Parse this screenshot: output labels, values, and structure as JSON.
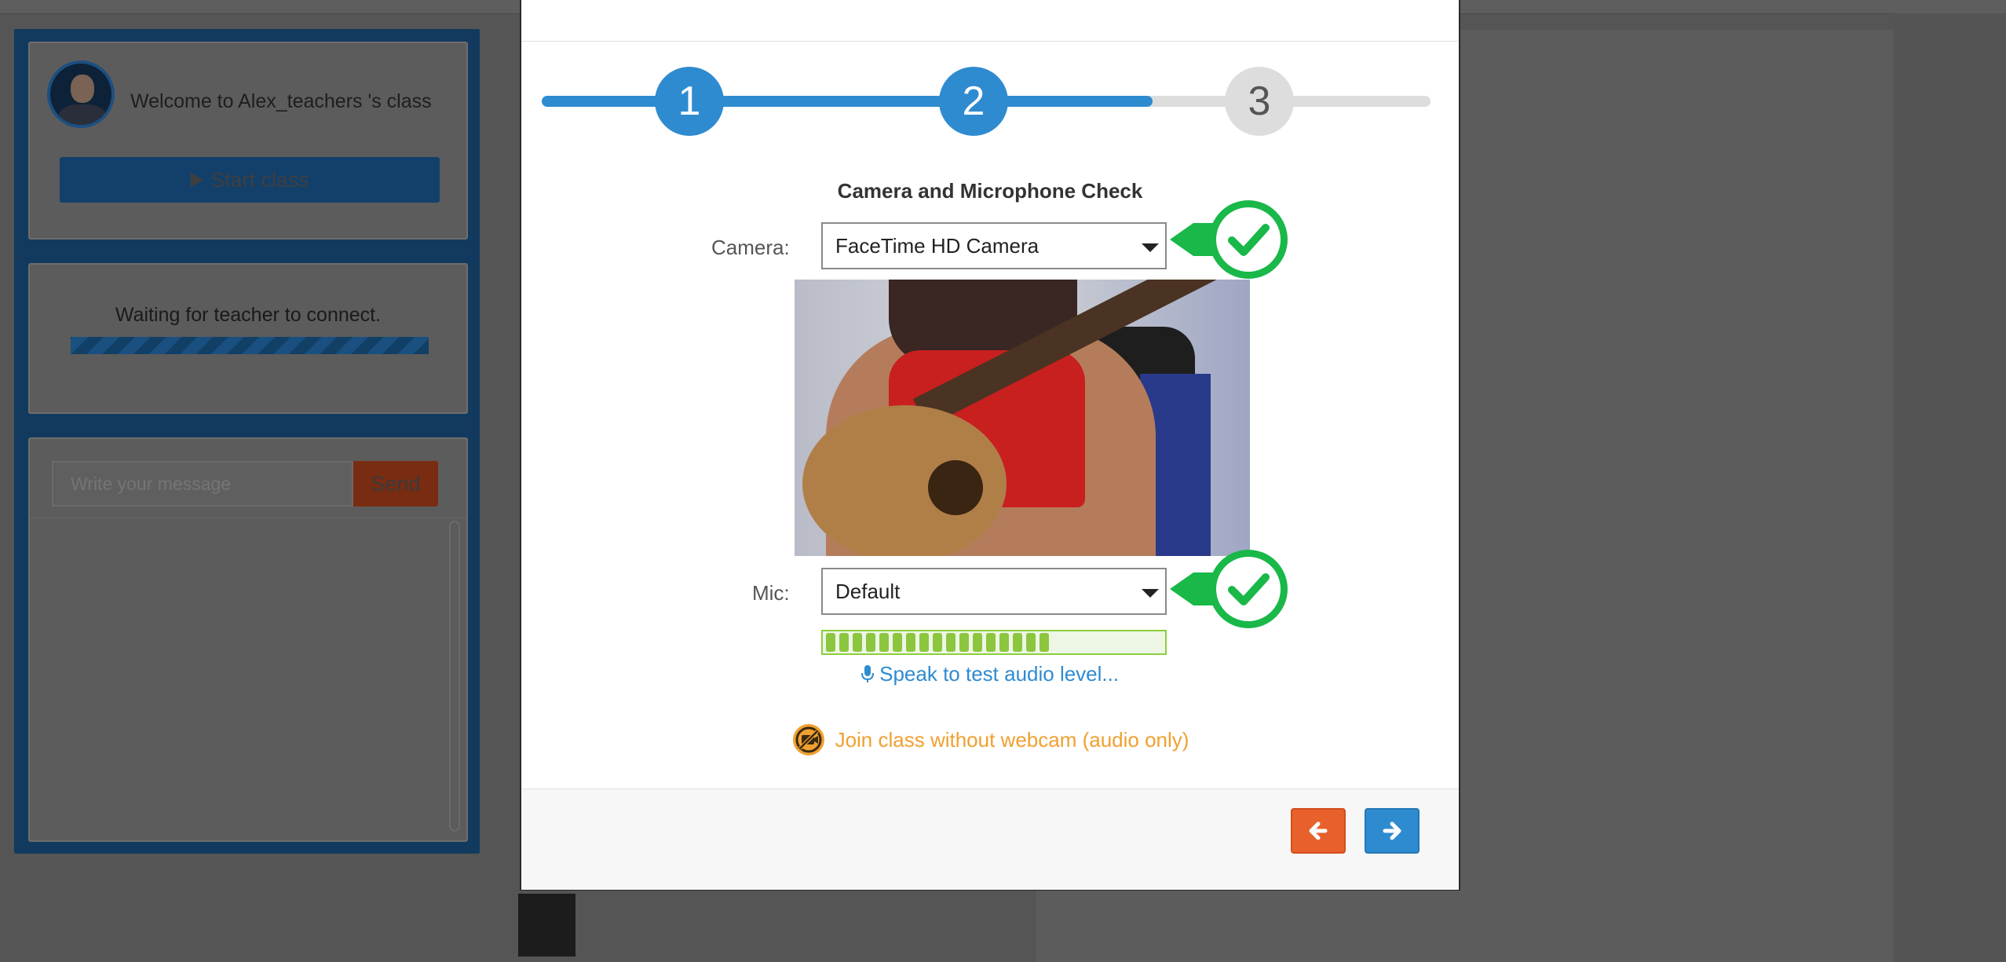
{
  "sidebar": {
    "welcome_text": "Welcome to Alex_teachers 's class",
    "start_button_label": "Start class",
    "waiting_text": "Waiting for teacher to connect.",
    "chat": {
      "input_placeholder": "Write your message",
      "send_label": "Send"
    }
  },
  "wizard": {
    "steps": [
      "1",
      "2",
      "3"
    ],
    "current_step": 2,
    "title": "Camera and Microphone Check",
    "camera": {
      "label": "Camera:",
      "selected": "FaceTime HD Camera",
      "status_icon": "check-icon"
    },
    "mic": {
      "label": "Mic:",
      "selected": "Default",
      "status_icon": "check-icon",
      "level_bars_filled": 17
    },
    "speak_text": "Speak to test audio level...",
    "audio_only_text": "Join class without webcam (audio only)",
    "footer": {
      "back_icon": "arrow-left-icon",
      "next_icon": "arrow-right-icon"
    }
  },
  "colors": {
    "accent_blue": "#2f8bd0",
    "inactive_grey": "#dddddd",
    "check_green": "#19b849",
    "back_orange": "#e8602c",
    "audio_only_orange": "#f0a030",
    "meter_green": "#8cc63f"
  }
}
